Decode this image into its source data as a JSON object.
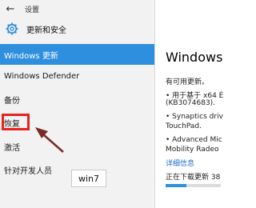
{
  "window": {
    "title": "设置"
  },
  "header": {
    "section_title": "更新和安全"
  },
  "nav": {
    "items": [
      {
        "label": "Windows 更新"
      },
      {
        "label": "Windows Defender"
      },
      {
        "label": "备份"
      },
      {
        "label": "恢复"
      },
      {
        "label": "激活"
      },
      {
        "label": "针对开发人员"
      }
    ]
  },
  "annotation": {
    "label": "win7"
  },
  "content": {
    "heading": "Windows",
    "available": "有可用更新。",
    "update1_line1": "• 用于基于 x64 É",
    "update1_line2": "(KB3074683).",
    "update2_line1": "• Synaptics driv",
    "update2_line2": "TouchPad.",
    "update3_line1": "• Advanced Mic",
    "update3_line2": "Mobility Radeo",
    "details_link": "详细信息",
    "status": "正在下载更新 38",
    "progress_percent": 38
  },
  "colors": {
    "accent": "#2e8fde",
    "highlight": "#e8231f",
    "arrow": "#7a2a25"
  }
}
